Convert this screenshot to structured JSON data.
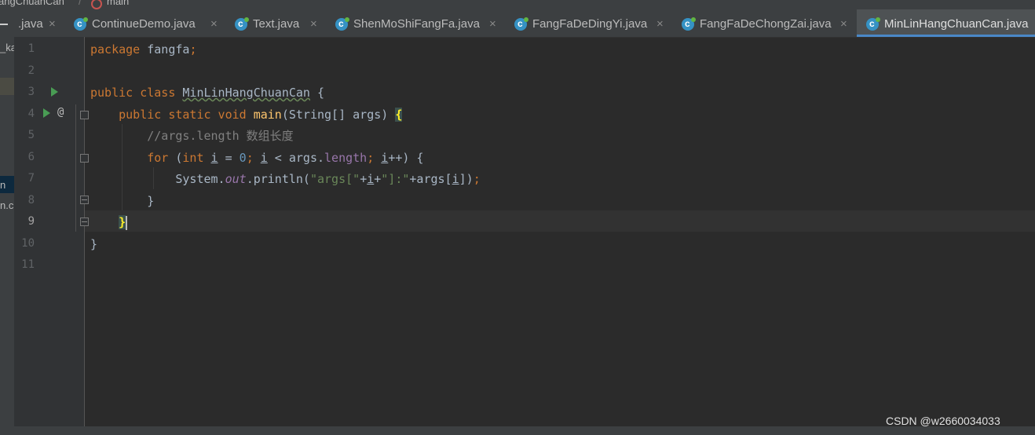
{
  "breadcrumb": {
    "class_crumb": "angChuanCan",
    "separator": "/",
    "method_crumb": "main",
    "method_icon": "method-icon"
  },
  "tabs": [
    {
      "label": ".java",
      "icon": "close-icon"
    },
    {
      "label": "ContinueDemo.java",
      "icon": "java-class-icon"
    },
    {
      "label": "Text.java",
      "icon": "java-class-icon"
    },
    {
      "label": "ShenMoShiFangFa.java",
      "icon": "java-class-icon"
    },
    {
      "label": "FangFaDeDingYi.java",
      "icon": "java-class-icon"
    },
    {
      "label": "FangFaDeChongZai.java",
      "icon": "java-class-icon"
    },
    {
      "label": "MinLinHangChuanCan.java",
      "icon": "java-class-icon",
      "active": true
    }
  ],
  "close_glyph": "×",
  "left_panel": {
    "item1": "_ka",
    "item2": "n",
    "item3": "n.c"
  },
  "line_numbers": [
    "1",
    "2",
    "3",
    "4",
    "5",
    "6",
    "7",
    "8",
    "9",
    "10",
    "11"
  ],
  "current_line": "9",
  "gutter": {
    "override_marker": "@",
    "run_icon": "run-icon"
  },
  "code": {
    "l1": {
      "kw": "package",
      "rest": " fangfa",
      "semi": ";"
    },
    "l3": {
      "kw": "public class",
      "name": "MinLinHangChuanCan",
      "rest": " {"
    },
    "l4": {
      "kw": "public static void",
      "fn": "main",
      "p1": "(String[] args) ",
      "brace": "{"
    },
    "l5": {
      "comment": "//args.length 数组长度"
    },
    "l6": {
      "kw": "for",
      "p1": " (",
      "kw2": "int",
      "var1": "i",
      "p2": " = ",
      "num": "0",
      "semi1": ";",
      "var2": "i",
      "p3": " < args.",
      "field": "length",
      "semi2": ";",
      "var3": "i",
      "p4": "++) {"
    },
    "l7": {
      "p1": "System.",
      "field": "out",
      "p2": ".println(",
      "str1": "\"args[\"",
      "p3": "+",
      "var": "i",
      "p4": "+",
      "str2": "\"]:\"",
      "p5": "+args[",
      "var2": "i",
      "p6": "])",
      "semi": ";"
    },
    "l8": {
      "text": "}"
    },
    "l9": {
      "brace": "}"
    },
    "l10": {
      "text": "}"
    }
  },
  "watermark": "CSDN @w2660034033",
  "colors": {
    "background": "#2b2b2b",
    "keyword": "#cc7832",
    "string": "#6a8759",
    "number": "#6897bb",
    "function": "#ffc66d",
    "field": "#9876aa",
    "comment": "#808080",
    "active_tab_underline": "#4a88c7"
  }
}
